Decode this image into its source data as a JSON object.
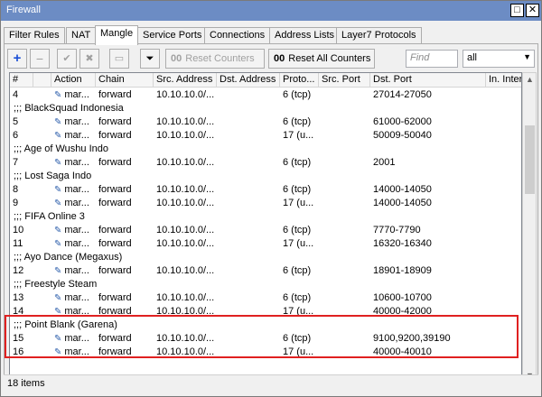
{
  "window": {
    "title": "Firewall",
    "restore_glyph": "□",
    "close_glyph": "✕"
  },
  "tabs": [
    "Filter Rules",
    "NAT",
    "Mangle",
    "Service Ports",
    "Connections",
    "Address Lists",
    "Layer7 Protocols"
  ],
  "active_tab": "Mangle",
  "toolbar": {
    "add_glyph": "+",
    "remove_glyph": "−",
    "enable_glyph": "✔",
    "disable_glyph": "✖",
    "comment_glyph": "▭",
    "filter_glyph": "⏷",
    "reset_counters": "Reset Counters",
    "reset_all_counters": "Reset All Counters",
    "oo_glyph": "00",
    "find_placeholder": "Find",
    "filter_select_value": "all"
  },
  "columns": [
    "#",
    "Action",
    "Chain",
    "Src. Address",
    "Dst. Address",
    "Proto...",
    "Src. Port",
    "Dst. Port",
    "In. Inter..."
  ],
  "rows": [
    {
      "type": "rule",
      "num": "4",
      "action": "mar...",
      "chain": "forward",
      "src": "10.10.10.0/...",
      "dst": "",
      "proto": "6 (tcp)",
      "sport": "",
      "dport": "27014-27050",
      "iniface": ""
    },
    {
      "type": "comment",
      "text": ";;; BlackSquad Indonesia"
    },
    {
      "type": "rule",
      "num": "5",
      "action": "mar...",
      "chain": "forward",
      "src": "10.10.10.0/...",
      "dst": "",
      "proto": "6 (tcp)",
      "sport": "",
      "dport": "61000-62000",
      "iniface": ""
    },
    {
      "type": "rule",
      "num": "6",
      "action": "mar...",
      "chain": "forward",
      "src": "10.10.10.0/...",
      "dst": "",
      "proto": "17 (u...",
      "sport": "",
      "dport": "50009-50040",
      "iniface": ""
    },
    {
      "type": "comment",
      "text": ";;; Age of Wushu Indo"
    },
    {
      "type": "rule",
      "num": "7",
      "action": "mar...",
      "chain": "forward",
      "src": "10.10.10.0/...",
      "dst": "",
      "proto": "6 (tcp)",
      "sport": "",
      "dport": "2001",
      "iniface": ""
    },
    {
      "type": "comment",
      "text": ";;; Lost Saga Indo"
    },
    {
      "type": "rule",
      "num": "8",
      "action": "mar...",
      "chain": "forward",
      "src": "10.10.10.0/...",
      "dst": "",
      "proto": "6 (tcp)",
      "sport": "",
      "dport": "14000-14050",
      "iniface": ""
    },
    {
      "type": "rule",
      "num": "9",
      "action": "mar...",
      "chain": "forward",
      "src": "10.10.10.0/...",
      "dst": "",
      "proto": "17 (u...",
      "sport": "",
      "dport": "14000-14050",
      "iniface": ""
    },
    {
      "type": "comment",
      "text": ";;; FIFA Online 3"
    },
    {
      "type": "rule",
      "num": "10",
      "action": "mar...",
      "chain": "forward",
      "src": "10.10.10.0/...",
      "dst": "",
      "proto": "6 (tcp)",
      "sport": "",
      "dport": "7770-7790",
      "iniface": ""
    },
    {
      "type": "rule",
      "num": "11",
      "action": "mar...",
      "chain": "forward",
      "src": "10.10.10.0/...",
      "dst": "",
      "proto": "17 (u...",
      "sport": "",
      "dport": "16320-16340",
      "iniface": ""
    },
    {
      "type": "comment",
      "text": ";;; Ayo Dance (Megaxus)"
    },
    {
      "type": "rule",
      "num": "12",
      "action": "mar...",
      "chain": "forward",
      "src": "10.10.10.0/...",
      "dst": "",
      "proto": "6 (tcp)",
      "sport": "",
      "dport": "18901-18909",
      "iniface": ""
    },
    {
      "type": "comment",
      "text": ";;; Freestyle Steam"
    },
    {
      "type": "rule",
      "num": "13",
      "action": "mar...",
      "chain": "forward",
      "src": "10.10.10.0/...",
      "dst": "",
      "proto": "6 (tcp)",
      "sport": "",
      "dport": "10600-10700",
      "iniface": ""
    },
    {
      "type": "rule",
      "num": "14",
      "action": "mar...",
      "chain": "forward",
      "src": "10.10.10.0/...",
      "dst": "",
      "proto": "17 (u...",
      "sport": "",
      "dport": "40000-42000",
      "iniface": ""
    },
    {
      "type": "comment",
      "text": ";;; Point Blank (Garena)"
    },
    {
      "type": "rule",
      "num": "15",
      "action": "mar...",
      "chain": "forward",
      "src": "10.10.10.0/...",
      "dst": "",
      "proto": "6 (tcp)",
      "sport": "",
      "dport": "9100,9200,39190",
      "iniface": ""
    },
    {
      "type": "rule",
      "num": "16",
      "action": "mar...",
      "chain": "forward",
      "src": "10.10.10.0/...",
      "dst": "",
      "proto": "17 (u...",
      "sport": "",
      "dport": "40000-40010",
      "iniface": ""
    }
  ],
  "status": {
    "items": "18 items"
  },
  "colors": {
    "titlebar": "#6c8cc4",
    "highlight_border": "#e02020",
    "pen_icon": "#2a5caa",
    "add_icon": "#1a4fd6"
  }
}
